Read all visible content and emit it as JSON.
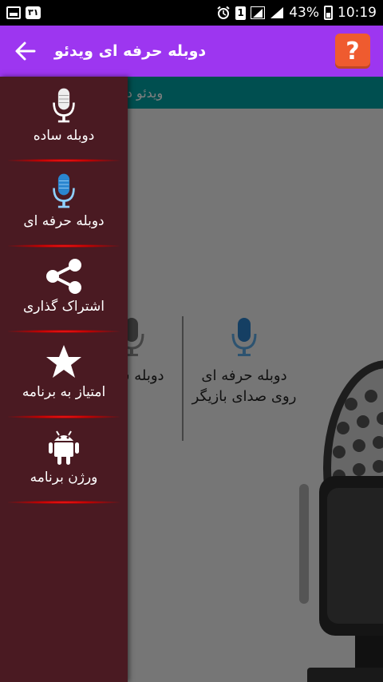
{
  "status_bar": {
    "notification_badge": "۳۱",
    "sim_label": "1",
    "battery": "43%",
    "time": "10:19"
  },
  "toolbar": {
    "title": "دوبله حرفه ای ویدئو",
    "help_label": "?",
    "background_color": "#9d36f0"
  },
  "main": {
    "banner_text": "ویدئو دوبله شده ای وجود ندارد",
    "options": [
      {
        "label": "دوبله حرفه ای روی صدای بازیگر",
        "icon": "microphone-blue-icon"
      },
      {
        "label": "دوبله ساده",
        "icon": "microphone-gray-icon"
      }
    ]
  },
  "drawer": {
    "items": [
      {
        "label": "دوبله ساده",
        "icon": "microphone-white-icon"
      },
      {
        "label": "دوبله حرفه ای",
        "icon": "microphone-blue-icon"
      },
      {
        "label": "اشتراک گذاری",
        "icon": "share-icon"
      },
      {
        "label": "امتیاز به برنامه",
        "icon": "star-icon"
      },
      {
        "label": "ورژن برنامه",
        "icon": "android-icon"
      }
    ],
    "background_color": "#4a1a22",
    "accent_color": "#d00000"
  }
}
